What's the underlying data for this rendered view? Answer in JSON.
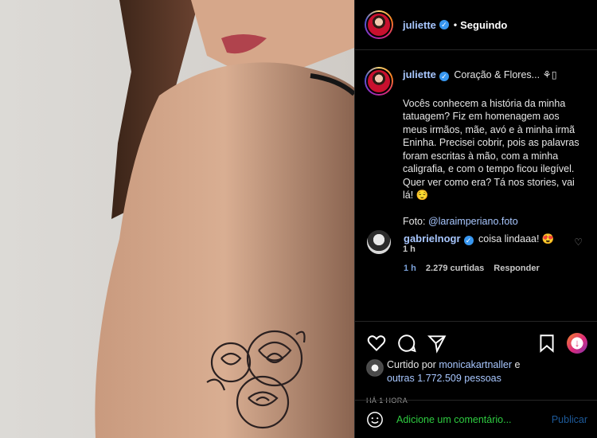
{
  "header": {
    "username": "juliette",
    "separator": "•",
    "follow_status": "Seguindo"
  },
  "caption": {
    "username": "juliette",
    "title": "Coração & Flores... ⚘▯",
    "body": "Vocês conhecem a história da minha tatuagem? Fiz em homenagem aos meus irmãos, mãe, avó e à minha irmã Eninha. Precisei cobrir, pois as palavras foram escritas à mão, com a minha caligrafia, e com o tempo ficou ilegível.\nQuer ver como era? Tá nos stories, vai lá! 😌\n\n",
    "photo_label": "Foto: ",
    "photo_mention": "@laraimperiano.foto",
    "time": "1 h"
  },
  "comment": {
    "username": "gabrielnogr",
    "text": "coisa lindaaa! 😍",
    "time": "1 h",
    "likes": "2.279 curtidas",
    "reply": "Responder"
  },
  "likes": {
    "prefix": "Curtido por ",
    "user": "monicakartnaller",
    "conj": " e",
    "others": "outras 1.772.509 pessoas"
  },
  "post_time": "HÁ 1 HORA",
  "add_comment": {
    "placeholder": "Adicione um comentário...",
    "post_label": "Publicar"
  },
  "icons": {
    "like": "heart-icon",
    "comment": "comment-icon",
    "share": "send-icon",
    "save": "bookmark-icon",
    "emoji": "emoji-icon",
    "notification": "notification-icon"
  },
  "colors": {
    "username": "#a8c7ff",
    "verified": "#3897f0",
    "placeholder": "#2ecc40",
    "background": "#000000"
  }
}
